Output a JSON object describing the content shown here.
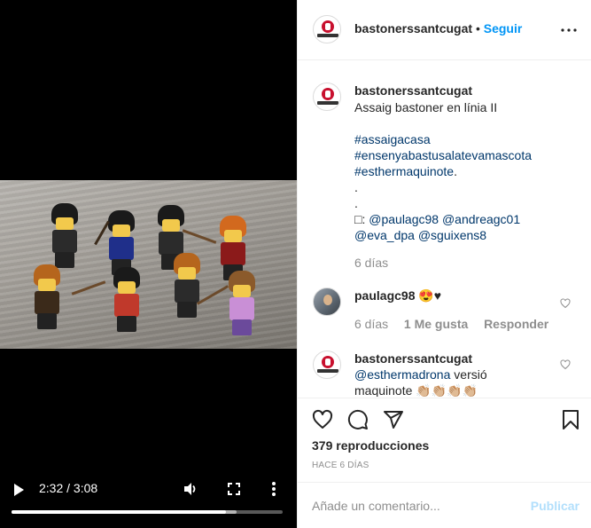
{
  "video": {
    "time_current": "2:32",
    "time_separator": "/",
    "time_total": "3:08",
    "progress": 0.79,
    "buffered": 0.83
  },
  "header": {
    "username": "bastonerssantcugat",
    "separator": "•",
    "follow_label": "Seguir"
  },
  "caption": {
    "username": "bastonerssantcugat",
    "text": "Assaig bastoner en línia II",
    "hashtags": [
      "#assaigacasa",
      "#ensenyabastusalatevamascota",
      "#esthermaquinote"
    ],
    "hashtag_trailing": ".",
    "dots": [
      ".",
      "."
    ],
    "credit_prefix": "□:",
    "mentions_line1": [
      "@paulagc98",
      "@andreagc01"
    ],
    "mentions_line2": [
      "@eva_dpa",
      "@sguixens8"
    ],
    "time": "6 días"
  },
  "comments": [
    {
      "username": "paulagc98",
      "text": "😍♥",
      "time": "6 días",
      "likes": "1 Me gusta",
      "reply_label": "Responder"
    },
    {
      "username": "bastonerssantcugat",
      "mention": "@esthermadrona",
      "text": " versió",
      "text2": "maquinote 👏🏼👏🏼👏🏼👏🏼"
    }
  ],
  "stats": {
    "views": "379 reproducciones",
    "date": "HACE 6 DÍAS"
  },
  "add_comment": {
    "placeholder": "Añade un comentario...",
    "publish_label": "Publicar"
  },
  "colors": {
    "accent": "#0095f6",
    "link": "#00376b",
    "muted": "#8e8e8e",
    "publish_disabled": "#b2dffc"
  },
  "icons": [
    "play-icon",
    "volume-icon",
    "fullscreen-icon",
    "video-menu-icon",
    "more-options-icon",
    "heart-icon",
    "comment-icon",
    "share-icon",
    "bookmark-icon"
  ]
}
